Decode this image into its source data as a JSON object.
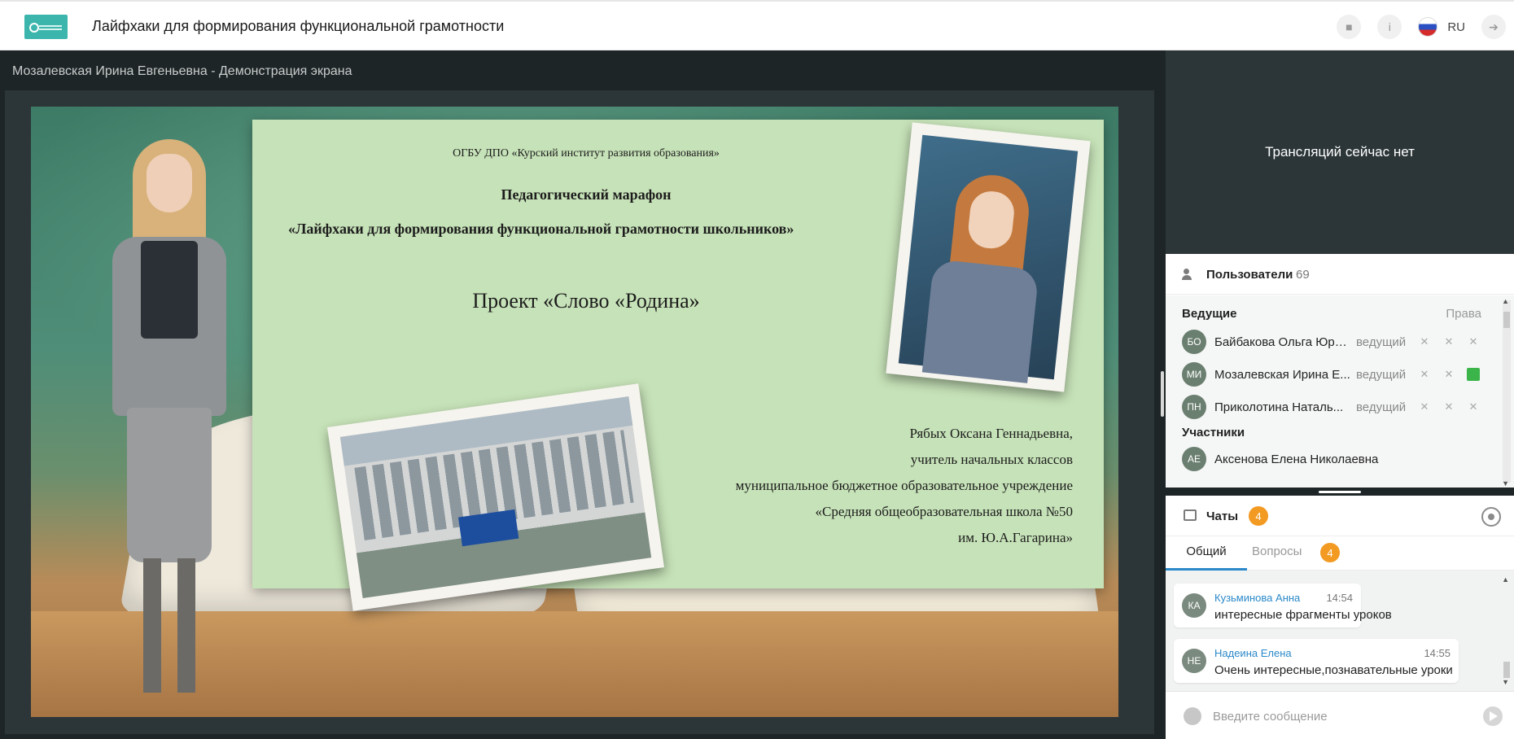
{
  "header": {
    "title": "Лайфхаки для формирования функциональной грамотности",
    "language": "RU",
    "icons": [
      "folder-icon",
      "info-icon",
      "russia-flag-icon",
      "exit-icon"
    ]
  },
  "stage": {
    "title": "Мозалевская Ирина Евгеньевна - Демонстрация экрана"
  },
  "slide": {
    "organization": "ОГБУ ДПО «Курский институт развития образования»",
    "subtitle": "Педагогический марафон",
    "marathon": "«Лайфхаки для формирования функциональной грамотности школьников»",
    "project": "Проект «Слово «Родина»",
    "author_lines": [
      "Рябых Оксана Геннадьевна,",
      "учитель начальных классов",
      "муниципальное бюджетное образовательное учреждение",
      "«Средняя общеобразовательная школа №50",
      "им. Ю.А.Гагарина»"
    ]
  },
  "broadcast": {
    "message": "Трансляций сейчас нет"
  },
  "users": {
    "title": "Пользователи",
    "count": "69",
    "hosts_label": "Ведущие",
    "rights_label": "Права",
    "participants_label": "Участники",
    "hosts": [
      {
        "initials": "БО",
        "name": "Байбакова Ольга Юрь...",
        "role": "ведущий",
        "screen_active": false
      },
      {
        "initials": "МИ",
        "name": "Мозалевская Ирина Е...",
        "role": "ведущий",
        "screen_active": true
      },
      {
        "initials": "ПН",
        "name": "Приколотина Наталь...",
        "role": "ведущий",
        "screen_active": false
      }
    ],
    "participants": [
      {
        "initials": "АЕ",
        "name": "Аксенова Елена Николаевна"
      }
    ]
  },
  "chats": {
    "title": "Чаты",
    "badge": "4",
    "tabs": [
      {
        "label": "Общий",
        "active": true
      },
      {
        "label": "Вопросы",
        "badge": "4",
        "active": false
      }
    ],
    "messages": [
      {
        "initials": "КА",
        "author": "Кузьминова Анна",
        "time": "14:54",
        "text": "интересные фрагменты уроков"
      },
      {
        "initials": "НЕ",
        "author": "Надеина Елена",
        "time": "14:55",
        "text": "Очень интересные,познавательные уроки"
      }
    ],
    "compose_placeholder": "Введите сообщение"
  },
  "colors": {
    "accent": "#2b89c9",
    "badge": "#f29a22",
    "screen_active": "#3bb54a",
    "dark_panel": "#1e2526"
  }
}
